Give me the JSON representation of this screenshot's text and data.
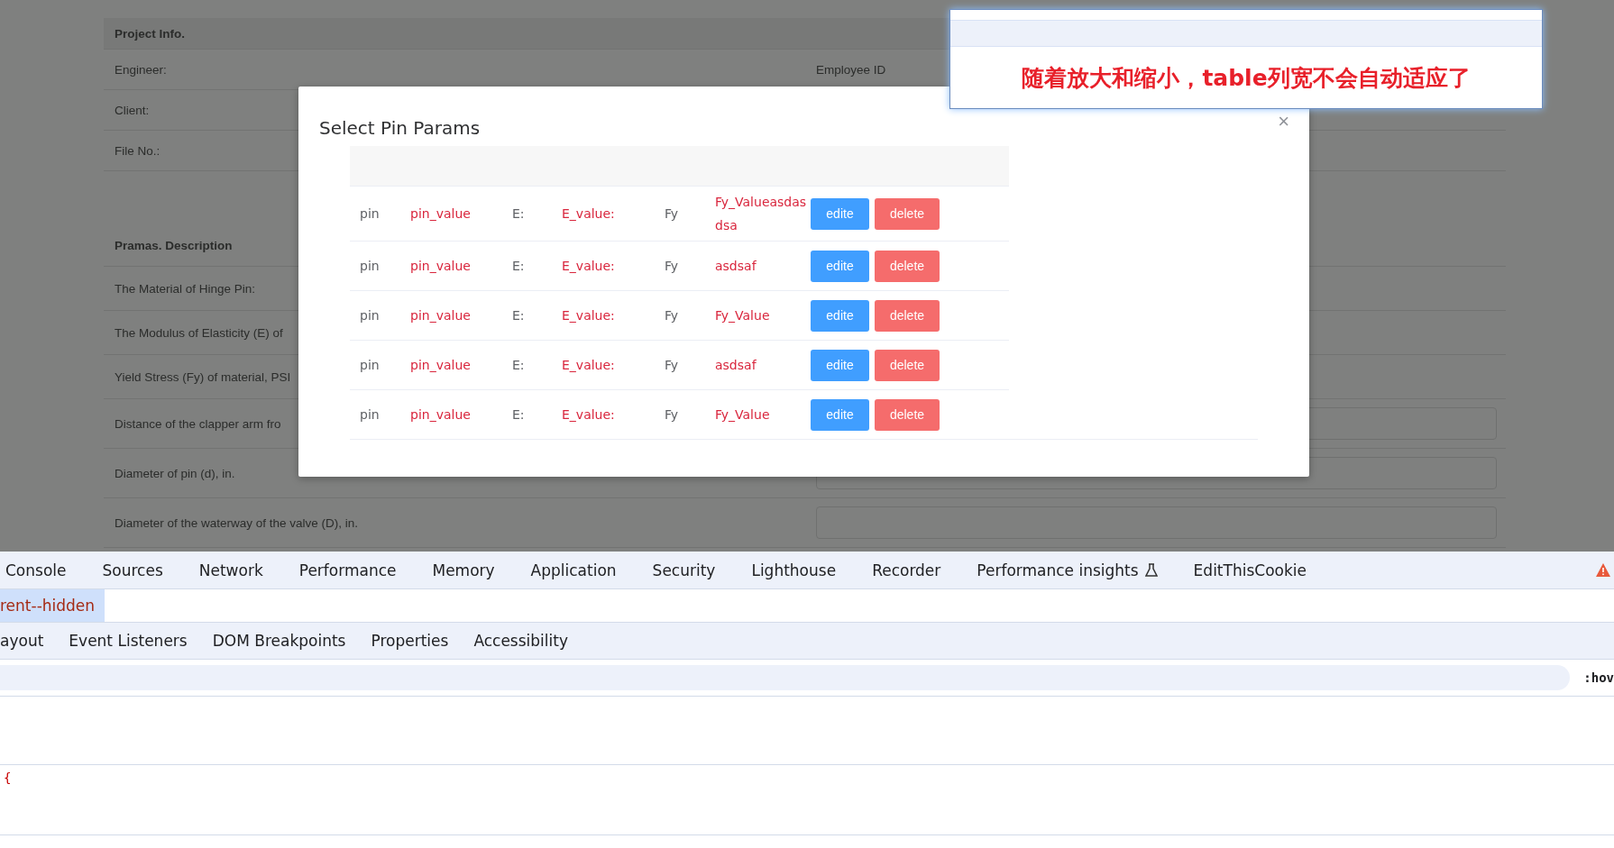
{
  "form": {
    "title": "Project Info.",
    "rows": [
      {
        "label": "Engineer:",
        "right_label": "Employee ID"
      },
      {
        "label": "Client:"
      },
      {
        "label": "File No.:"
      }
    ],
    "params_title": "Pramas. Description",
    "params": [
      {
        "label": "The Material of Hinge Pin:",
        "field": false
      },
      {
        "label": "The Modulus of Elasticity (E) of",
        "field": false
      },
      {
        "label": "Yield Stress (Fy) of material, PSI",
        "field": false
      },
      {
        "label": "Distance of the clapper arm fro",
        "field": true
      },
      {
        "label": "Diameter of pin (d), in.",
        "field": true
      },
      {
        "label": "Diameter of the waterway of the valve (D), in.",
        "field": true
      }
    ]
  },
  "modal": {
    "title": "Select Pin Params",
    "close": "×",
    "rows": [
      {
        "c1": "pin",
        "c2": "pin_value",
        "c3": "E:",
        "c4": "E_value:",
        "c5": "Fy",
        "c6": "Fy_Valueasdasdsa",
        "edit": "edite",
        "delete": "delete"
      },
      {
        "c1": "pin",
        "c2": "pin_value",
        "c3": "E:",
        "c4": "E_value:",
        "c5": "Fy",
        "c6": "asdsaf",
        "edit": "edite",
        "delete": "delete"
      },
      {
        "c1": "pin",
        "c2": "pin_value",
        "c3": "E:",
        "c4": "E_value:",
        "c5": "Fy",
        "c6": "Fy_Value",
        "edit": "edite",
        "delete": "delete"
      },
      {
        "c1": "pin",
        "c2": "pin_value",
        "c3": "E:",
        "c4": "E_value:",
        "c5": "Fy",
        "c6": "asdsaf",
        "edit": "edite",
        "delete": "delete"
      },
      {
        "c1": "pin",
        "c2": "pin_value",
        "c3": "E:",
        "c4": "E_value:",
        "c5": "Fy",
        "c6": "Fy_Value",
        "edit": "edite",
        "delete": "delete"
      }
    ]
  },
  "annotation": {
    "text": "随着放大和缩小，table列宽不会自动适应了"
  },
  "devtools": {
    "tabs": [
      {
        "label": "Console",
        "experimental": false
      },
      {
        "label": "Sources",
        "experimental": false
      },
      {
        "label": "Network",
        "experimental": false
      },
      {
        "label": "Performance",
        "experimental": false
      },
      {
        "label": "Memory",
        "experimental": false
      },
      {
        "label": "Application",
        "experimental": false
      },
      {
        "label": "Security",
        "experimental": false
      },
      {
        "label": "Lighthouse",
        "experimental": false
      },
      {
        "label": "Recorder",
        "experimental": false
      },
      {
        "label": "Performance insights",
        "experimental": true
      },
      {
        "label": "EditThisCookie",
        "experimental": false
      }
    ],
    "breadcrumb": "rent--hidden",
    "sub_tabs": [
      "ayout",
      "Event Listeners",
      "DOM Breakpoints",
      "Properties",
      "Accessibility"
    ],
    "filter_suffix": ":hov",
    "style_text": "{"
  }
}
